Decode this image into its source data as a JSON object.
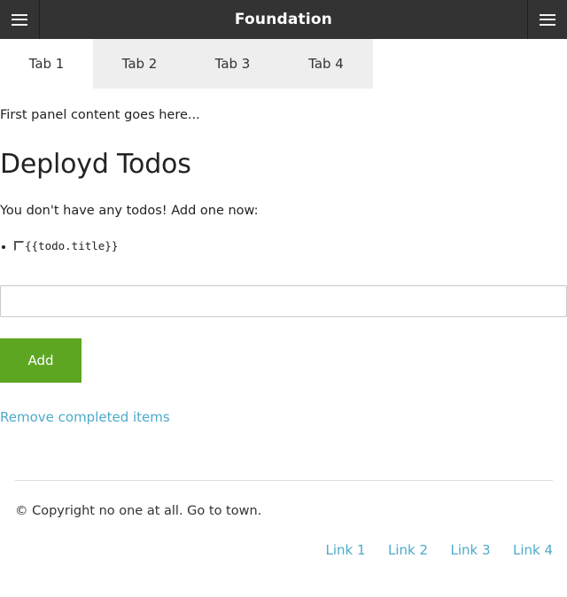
{
  "header": {
    "title": "Foundation",
    "left_menu_icon": "hamburger-menu-icon",
    "right_menu_icon": "hamburger-menu-icon"
  },
  "tabs": [
    {
      "label": "Tab 1",
      "active": true
    },
    {
      "label": "Tab 2",
      "active": false
    },
    {
      "label": "Tab 3",
      "active": false
    },
    {
      "label": "Tab 4",
      "active": false
    }
  ],
  "panel": {
    "intro": "First panel content goes here...",
    "heading": "Deployd Todos",
    "empty_message": "You don't have any todos! Add one now:",
    "todo_item_template": "{{todo.title}}",
    "checkbox_icon": "checkbox-unchecked-icon",
    "input_value": "",
    "input_placeholder": "",
    "add_label": "Add",
    "remove_label": "Remove completed items"
  },
  "footer": {
    "copyright": "© Copyright no one at all. Go to town.",
    "links": [
      {
        "label": "Link 1"
      },
      {
        "label": "Link 2"
      },
      {
        "label": "Link 3"
      },
      {
        "label": "Link 4"
      }
    ]
  },
  "colors": {
    "header_bg": "#333333",
    "tab_inactive_bg": "#eeeeee",
    "accent_green": "#5da622",
    "link_blue": "#4daacb",
    "rule": "#dddddd"
  }
}
